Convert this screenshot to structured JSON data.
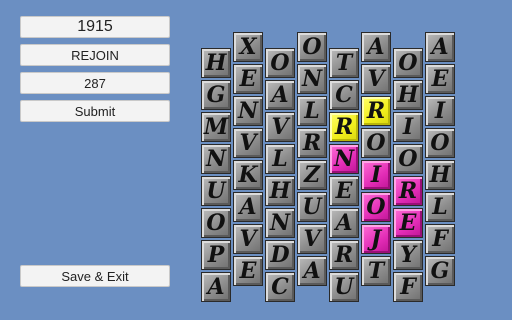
{
  "panel": {
    "score": "1915",
    "current_word": "REJOIN",
    "word_points": "287",
    "submit_label": "Submit",
    "save_exit_label": "Save & Exit"
  },
  "board": {
    "columns": [
      {
        "letters": [
          "H",
          "G",
          "M",
          "N",
          "U",
          "O",
          "P",
          "A"
        ]
      },
      {
        "letters": [
          "X",
          "E",
          "N",
          "V",
          "K",
          "A",
          "V",
          "E"
        ]
      },
      {
        "letters": [
          "O",
          "A",
          "V",
          "L",
          "H",
          "N",
          "D",
          "C"
        ]
      },
      {
        "letters": [
          "O",
          "N",
          "L",
          "R",
          "Z",
          "U",
          "V",
          "A"
        ]
      },
      {
        "letters": [
          "T",
          "C",
          "R",
          "N",
          "E",
          "A",
          "R",
          "U"
        ]
      },
      {
        "letters": [
          "A",
          "V",
          "R",
          "O",
          "I",
          "O",
          "J",
          "T"
        ]
      },
      {
        "letters": [
          "O",
          "H",
          "I",
          "O",
          "R",
          "E",
          "Y",
          "F"
        ]
      },
      {
        "letters": [
          "A",
          "E",
          "I",
          "O",
          "H",
          "L",
          "F",
          "G"
        ]
      }
    ],
    "highlights": {
      "4-2": "yellow",
      "5-2": "yellow",
      "4-3": "pink",
      "5-4": "pink",
      "5-5": "pink",
      "5-6": "pink",
      "6-4": "pink",
      "6-5": "pink"
    },
    "colors": {
      "background": "#6b8fc2",
      "tile": "#9a9a9a",
      "selected_yellow": "#f1ef1c",
      "selected_pink": "#e22cb6"
    }
  }
}
